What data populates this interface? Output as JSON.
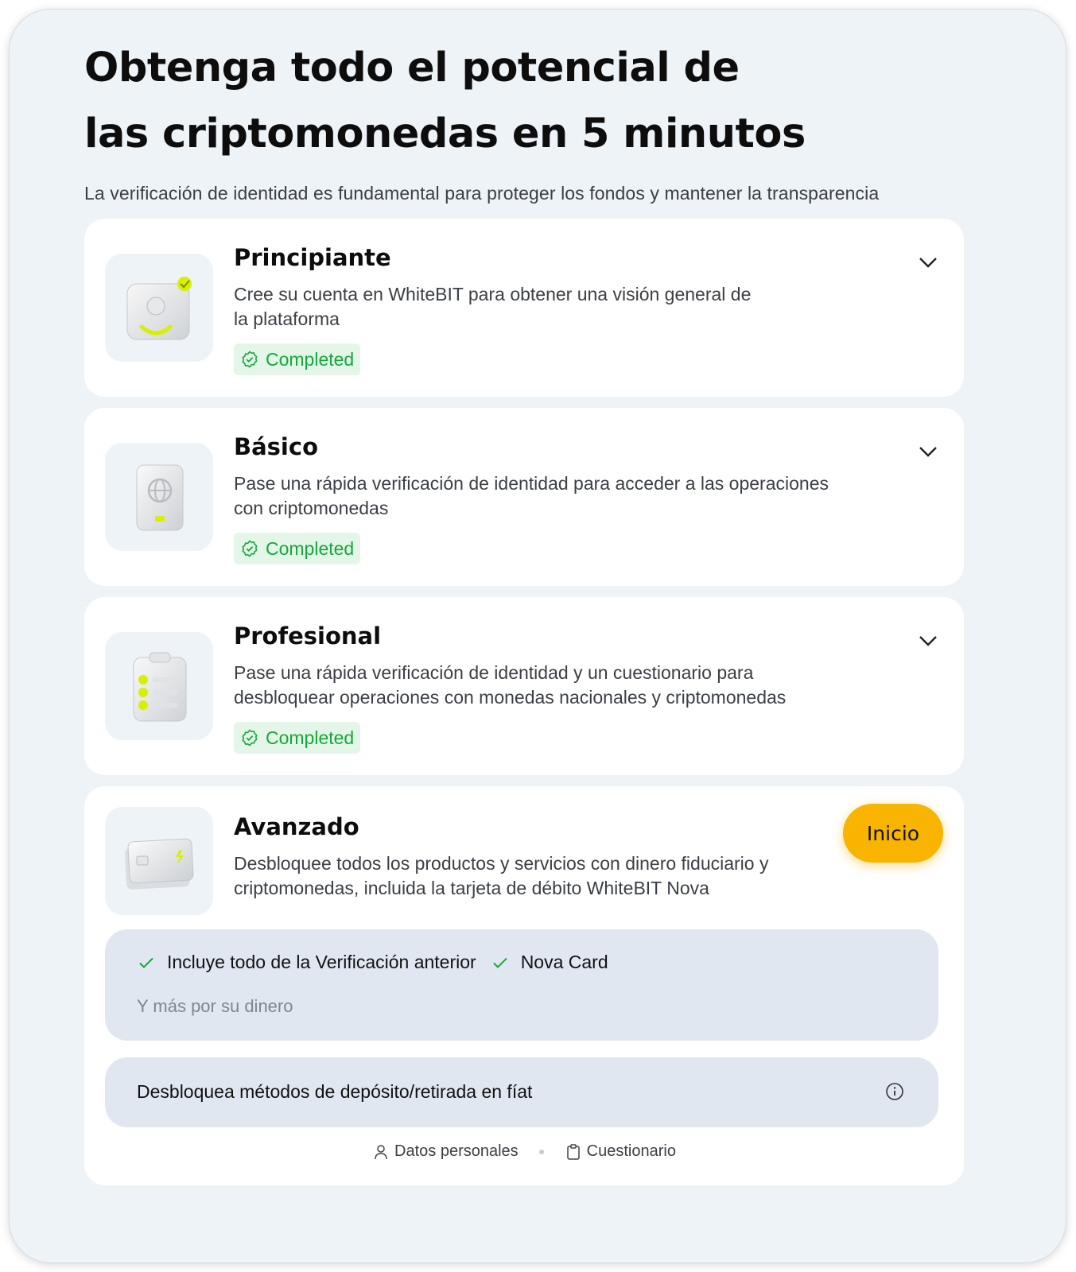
{
  "header": {
    "title": "Obtenga todo el potencial de\nlas criptomonedas en 5 minutos",
    "subtitle": "La verificación de identidad es fundamental para proteger los fondos y mantener la transparencia"
  },
  "levels": [
    {
      "title": "Principiante",
      "description": "Cree su cuenta en WhiteBIT para obtener una visión general de\nla plataforma",
      "status": "Completed",
      "icon": "user-card-icon"
    },
    {
      "title": "Básico",
      "description": "Pase una rápida verificación de identidad para acceder a las operaciones\ncon criptomonedas",
      "status": "Completed",
      "icon": "passport-icon"
    },
    {
      "title": "Profesional",
      "description": "Pase una rápida verificación de identidad y un cuestionario para\ndesbloquear operaciones con monedas nacionales y criptomonedas",
      "status": "Completed",
      "icon": "checklist-icon"
    },
    {
      "title": "Avanzado",
      "description": "Desbloquee todos los productos y servicios con dinero fiduciario y\ncriptomonedas, incluida la tarjeta de débito WhiteBIT Nova",
      "button": "Inicio",
      "icon": "debit-card-icon",
      "features": [
        "Incluye todo de la Verificación anterior",
        "Nova Card"
      ],
      "more": "Y más por su dinero",
      "unlock": "Desbloquea métodos de depósito/retirada en fíat",
      "requirements": [
        "Datos personales",
        "Cuestionario"
      ]
    }
  ],
  "colors": {
    "accent": "#f9b400",
    "success": "#14a83a",
    "success_bg": "#e4f6e8",
    "page_bg": "#eef3f8",
    "panel_bg": "#e1e7f1",
    "highlight": "#d6f000"
  }
}
